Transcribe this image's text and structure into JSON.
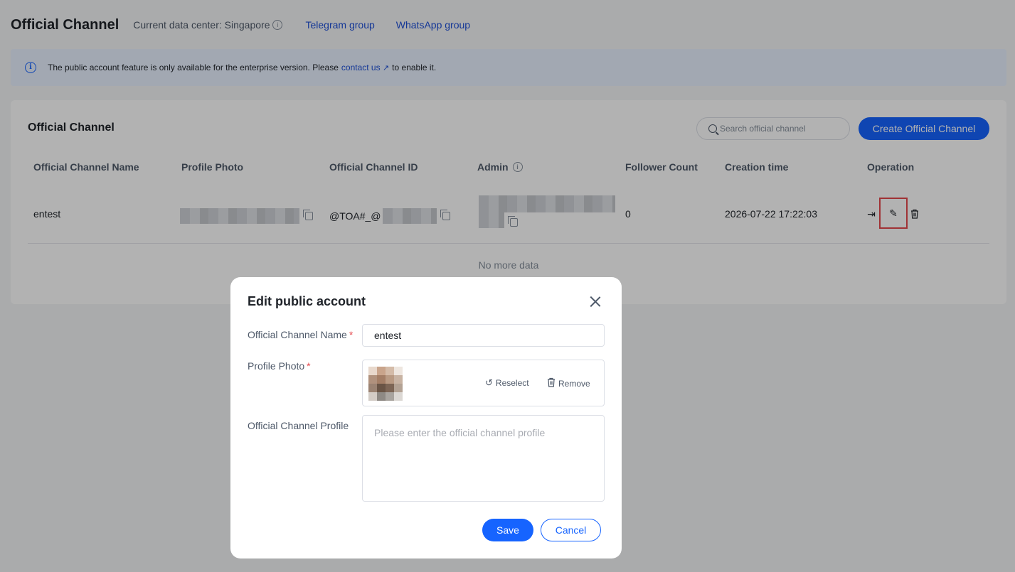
{
  "header": {
    "title": "Official Channel",
    "data_center": "Current data center: Singapore",
    "links": [
      "Telegram group",
      "WhatsApp group"
    ]
  },
  "banner": {
    "text_before": "The public account feature is only available for the enterprise version. Please",
    "link": "contact us",
    "text_after": "to enable it."
  },
  "card": {
    "title": "Official Channel",
    "search_placeholder": "Search official channel",
    "create_label": "Create Official Channel",
    "columns": [
      "Official Channel Name",
      "Profile Photo",
      "Official Channel ID",
      "Admin",
      "Follower Count",
      "Creation time",
      "Operation"
    ],
    "rows": [
      {
        "name": "entest",
        "channel_id": "@TOA#_@",
        "follower_count": "0",
        "creation_time": "2026-07-22 17:22:03"
      }
    ],
    "no_more": "No more data"
  },
  "modal": {
    "title": "Edit public account",
    "name_label": "Official Channel Name",
    "name_value": "entest",
    "photo_label": "Profile Photo",
    "reselect_label": "Reselect",
    "remove_label": "Remove",
    "profile_label": "Official Channel Profile",
    "profile_placeholder": "Please enter the official channel profile",
    "save_label": "Save",
    "cancel_label": "Cancel"
  },
  "colors": {
    "primary": "#1664ff",
    "highlight": "#e5484d",
    "banner_bg": "#e8f1ff"
  }
}
